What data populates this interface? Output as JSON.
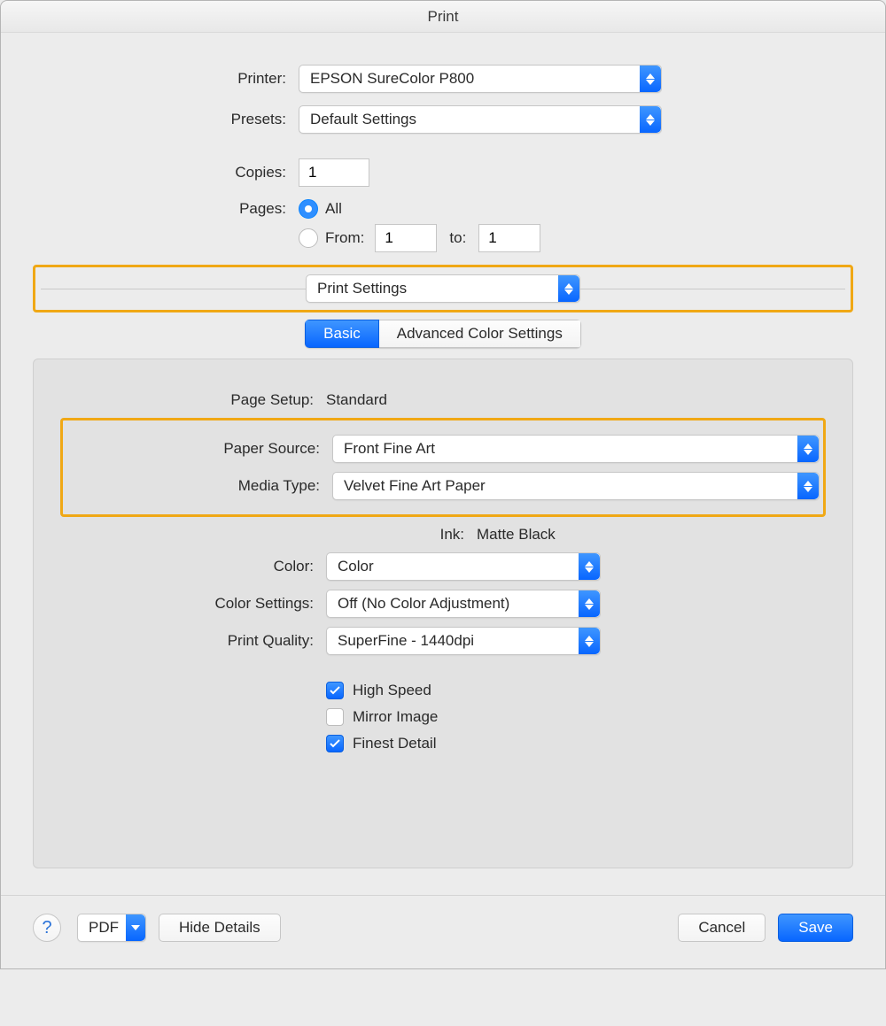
{
  "title": "Print",
  "labels": {
    "printer": "Printer:",
    "presets": "Presets:",
    "copies": "Copies:",
    "pages": "Pages:",
    "all": "All",
    "from": "From:",
    "to": "to:",
    "page_setup": "Page Setup:",
    "paper_source": "Paper Source:",
    "media_type": "Media Type:",
    "ink": "Ink:",
    "color": "Color:",
    "color_settings": "Color Settings:",
    "print_quality": "Print Quality:"
  },
  "values": {
    "printer": "EPSON SureColor P800",
    "presets": "Default Settings",
    "copies": "1",
    "from": "1",
    "to": "1",
    "section": "Print Settings",
    "page_setup": "Standard",
    "paper_source": "Front Fine Art",
    "media_type": "Velvet Fine Art Paper",
    "ink": "Matte Black",
    "color": "Color",
    "color_settings": "Off (No Color Adjustment)",
    "print_quality": "SuperFine - 1440dpi"
  },
  "tabs": {
    "basic": "Basic",
    "advanced": "Advanced Color Settings"
  },
  "checks": {
    "high_speed": "High Speed",
    "mirror_image": "Mirror Image",
    "finest_detail": "Finest Detail"
  },
  "footer": {
    "pdf": "PDF",
    "hide_details": "Hide Details",
    "cancel": "Cancel",
    "save": "Save"
  },
  "help_glyph": "?"
}
